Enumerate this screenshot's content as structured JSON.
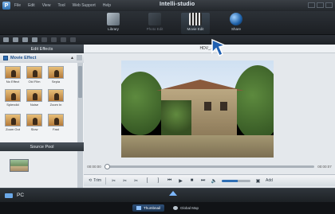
{
  "app": {
    "title": "Intelli-studio"
  },
  "menu": [
    "File",
    "Edit",
    "View",
    "Tool",
    "Web Support",
    "Help"
  ],
  "modes": [
    {
      "label": "Library",
      "icon": "library-icon"
    },
    {
      "label": "Photo Edit",
      "icon": "photo-edit-icon"
    },
    {
      "label": "Movie Edit",
      "icon": "movie-edit-icon"
    },
    {
      "label": "Share",
      "icon": "share-icon"
    }
  ],
  "left": {
    "edit_effects": "Edit Effects",
    "effect_group": "Movie Effect",
    "effects": [
      "No Effect",
      "Old Film",
      "Sepia",
      "Splendid",
      "Noise",
      "Zoom In",
      "Zoom Out",
      "Slow",
      "Fast"
    ],
    "source_pool": "Source Pool"
  },
  "preview": {
    "file_label": "HDV_…_1",
    "time_start": "00:00:00",
    "time_end": "00:00:07",
    "progress": 0.0
  },
  "controls": {
    "trim": "Trim",
    "add": "Add"
  },
  "bottom": {
    "pc": "PC",
    "thumbnail": "Thumbnail",
    "global_map": "Global Map"
  },
  "colors": {
    "accent": "#2f6fb5",
    "dark": "#1b1e22"
  }
}
